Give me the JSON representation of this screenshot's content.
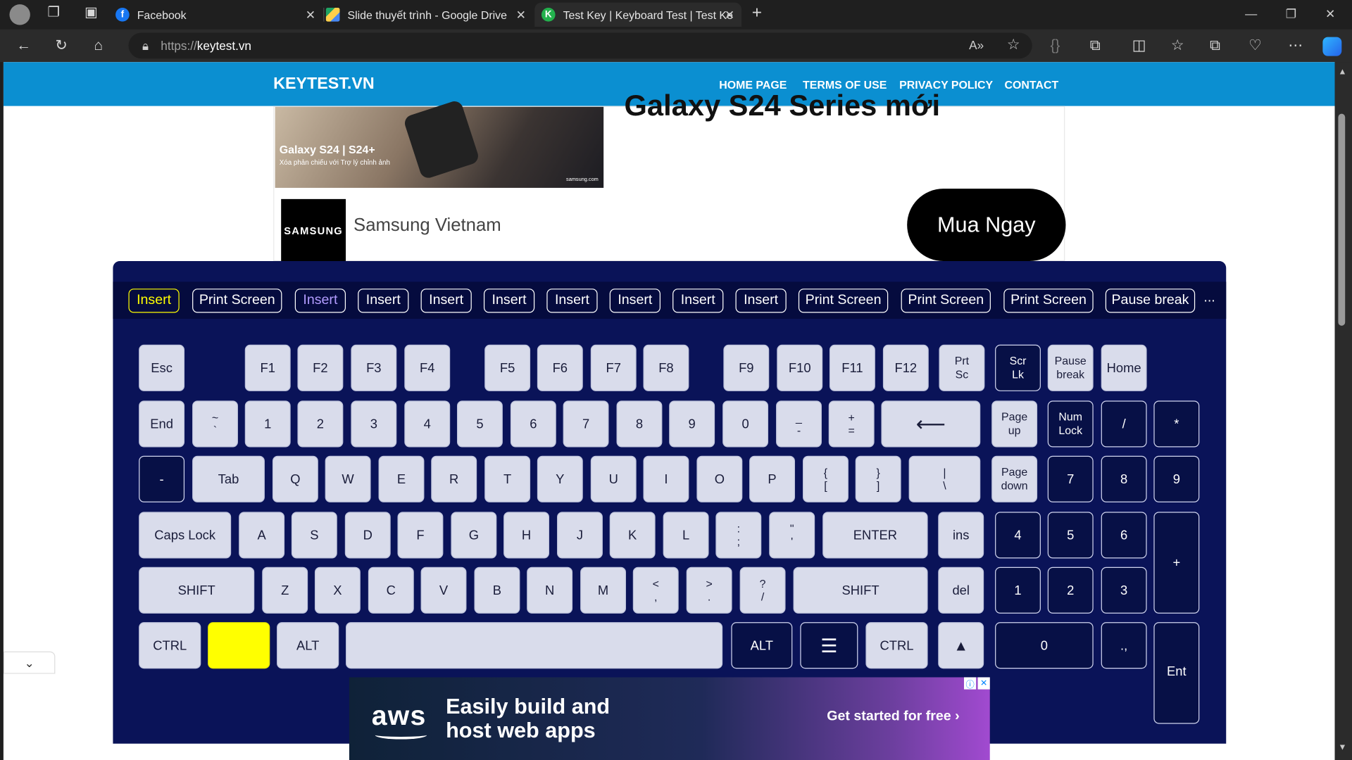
{
  "browser": {
    "tabs": [
      {
        "title": "Facebook",
        "icon": "facebook-icon",
        "color": "#1877f2"
      },
      {
        "title": "Slide thuyết trình - Google Drive",
        "icon": "google-drive-icon",
        "color": "#1fa463"
      },
      {
        "title": "Test Key | Keyboard Test | Test Ke",
        "icon": "keytest-icon",
        "color": "#23b14d"
      }
    ],
    "address": {
      "scheme": "https://",
      "host": "keytest.vn"
    }
  },
  "site": {
    "brand": "KEYTEST.VN",
    "menu": [
      "HOME PAGE",
      "TERMS OF USE",
      "PRIVACY POLICY",
      "CONTACT"
    ],
    "accent": "#0b8fd1"
  },
  "ad_top": {
    "image_title": "Galaxy S24 | S24+",
    "image_subtitle": "Xóa phản chiếu với Trợ lý chỉnh ảnh",
    "image_source": "samsung.com",
    "headline": "Galaxy S24 Series mới",
    "advertiser_logo": "SAMSUNG",
    "advertiser": "Samsung Vietnam",
    "cta": "Mua Ngay"
  },
  "history": [
    "Insert",
    "Print Screen",
    "Insert",
    "Insert",
    "Insert",
    "Insert",
    "Insert",
    "Insert",
    "Insert",
    "Insert",
    "Print Screen",
    "Print Screen",
    "Print Screen",
    "Pause break"
  ],
  "history_more": "...",
  "keys": {
    "esc": "Esc",
    "f1": "F1",
    "f2": "F2",
    "f3": "F3",
    "f4": "F4",
    "f5": "F5",
    "f6": "F6",
    "f7": "F7",
    "f8": "F8",
    "f9": "F9",
    "f10": "F10",
    "f11": "F11",
    "f12": "F12",
    "prtsc_top": "Prt",
    "prtsc_bot": "Sc",
    "scrlk_top": "Scr",
    "scrlk_bot": "Lk",
    "pause_top": "Pause",
    "pause_bot": "break",
    "home": "Home",
    "end": "End",
    "tilde_top": "~",
    "tilde_bot": "`",
    "n1": "1",
    "n2": "2",
    "n3": "3",
    "n4": "4",
    "n5": "5",
    "n6": "6",
    "n7": "7",
    "n8": "8",
    "n9": "9",
    "n0": "0",
    "minus_top": "_",
    "minus_bot": "-",
    "equal_top": "+",
    "equal_bot": "=",
    "backspace": "⟵",
    "pgup_top": "Page",
    "pgup_bot": "up",
    "numlock_top": "Num",
    "numlock_bot": "Lock",
    "np_div": "/",
    "np_mul": "*",
    "np_minus": "-",
    "tab": "Tab",
    "q": "Q",
    "w": "W",
    "e": "E",
    "r": "R",
    "t": "T",
    "y": "Y",
    "u": "U",
    "i": "I",
    "o": "O",
    "p": "P",
    "lbr_top": "{",
    "lbr_bot": "[",
    "rbr_top": "}",
    "rbr_bot": "]",
    "bsl_top": "|",
    "bsl_bot": "\\",
    "pgdn_top": "Page",
    "pgdn_bot": "down",
    "np7": "7",
    "np8": "8",
    "np9": "9",
    "caps": "Caps Lock",
    "a": "A",
    "s": "S",
    "d": "D",
    "f": "F",
    "g": "G",
    "h": "H",
    "j": "J",
    "k": "K",
    "l": "L",
    "semi_top": ":",
    "semi_bot": ";",
    "quote_top": "\"",
    "quote_bot": "'",
    "enter": "ENTER",
    "ins": "ins",
    "np4": "4",
    "np5": "5",
    "np6": "6",
    "np_plus": "+",
    "shift_l": "SHIFT",
    "z": "Z",
    "x": "X",
    "c": "C",
    "v": "V",
    "b": "B",
    "n": "N",
    "m": "M",
    "comma_top": "<",
    "comma_bot": ",",
    "period_top": ">",
    "period_bot": ".",
    "slash_top": "?",
    "slash_bot": "/",
    "shift_r": "SHIFT",
    "del": "del",
    "np1": "1",
    "np2": "2",
    "np3": "3",
    "ctrl_l": "CTRL",
    "win": "",
    "alt_l": "ALT",
    "space": "",
    "alt_r": "ALT",
    "menu": "☰",
    "ctrl_r": "CTRL",
    "up": "▲",
    "np0": "0",
    "np_dot": ".,",
    "np_enter": "Ent"
  },
  "ad_bottom": {
    "logo": "aws",
    "line1": "Easily build and",
    "line2": "host web apps",
    "cta": "Get started for free ›"
  }
}
